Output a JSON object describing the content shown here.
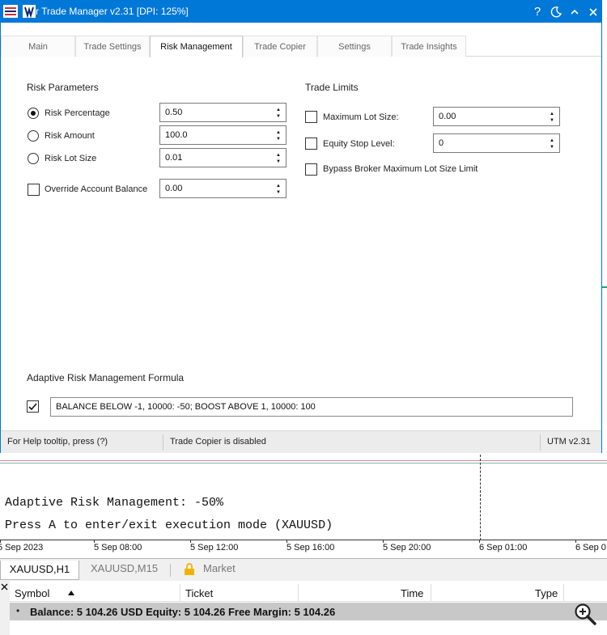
{
  "window": {
    "title": "r Trade Manager v2.31 [DPI: 125%]",
    "help_icon": "?",
    "theme_icon": "moon-icon",
    "collapse_icon": "chevron-up-icon",
    "close_icon": "close-icon"
  },
  "tabs": [
    "Main",
    "Trade Settings",
    "Risk Management",
    "Trade Copier",
    "Settings",
    "Trade Insights"
  ],
  "active_tab": "Risk Management",
  "risk_parameters": {
    "title": "Risk Parameters",
    "options": [
      {
        "label": "Risk Percentage",
        "value": "0.50",
        "selected": true
      },
      {
        "label": "Risk Amount",
        "value": "100.0",
        "selected": false
      },
      {
        "label": "Risk Lot Size",
        "value": "0.01",
        "selected": false
      }
    ],
    "override": {
      "label": "Override Account Balance",
      "value": "0.00",
      "checked": false
    }
  },
  "trade_limits": {
    "title": "Trade Limits",
    "max_lot": {
      "label": "Maximum Lot Size:",
      "value": "0.00",
      "checked": false
    },
    "equity_stop": {
      "label": "Equity Stop Level:",
      "value": "0",
      "checked": false
    },
    "bypass": {
      "label": "Bypass Broker Maximum Lot Size Limit",
      "checked": false
    }
  },
  "adaptive": {
    "title": "Adaptive Risk Management Formula",
    "checked": true,
    "formula": "BALANCE BELOW -1, 10000: -50; BOOST ABOVE 1, 10000: 100"
  },
  "status": {
    "help": "For Help tooltip, press (?)",
    "copier": "Trade Copier is disabled",
    "version": "UTM v2.31"
  },
  "chart": {
    "line1": "Adaptive Risk Management: -50%",
    "line2": "Press A to enter/exit execution mode (XAUUSD)",
    "time_labels": [
      "5 Sep 2023",
      "5 Sep 08:00",
      "5 Sep 12:00",
      "5 Sep 16:00",
      "5 Sep 20:00",
      "6 Sep 01:00",
      "6 Sep 0"
    ]
  },
  "symbol_tabs": [
    "XAUUSD,H1",
    "XAUUSD,M15",
    "Market"
  ],
  "table": {
    "headers": [
      "Symbol",
      "Ticket",
      "Time",
      "Type"
    ],
    "balance_row": "Balance: 5 104.26 USD  Equity: 5 104.26  Free Margin: 5 104.26"
  },
  "colors": {
    "titlebar": "#0078d7",
    "accent_green": "#1aa37a"
  }
}
